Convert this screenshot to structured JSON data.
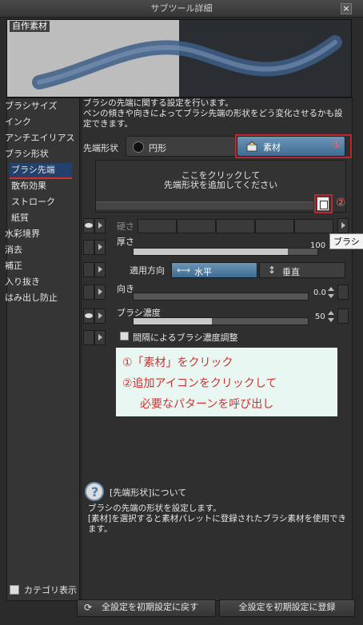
{
  "window": {
    "title": "サブツール詳細",
    "close_icon": "close-icon"
  },
  "preview": {
    "label": "自作素材"
  },
  "sidebar": {
    "items": [
      {
        "label": "ブラシサイズ",
        "sub": false
      },
      {
        "label": "インク",
        "sub": false
      },
      {
        "label": "アンチエイリアス",
        "sub": false
      },
      {
        "label": "ブラシ形状",
        "sub": false
      },
      {
        "label": "ブラシ先端",
        "sub": true,
        "active": true
      },
      {
        "label": "散布効果",
        "sub": true
      },
      {
        "label": "ストローク",
        "sub": true
      },
      {
        "label": "紙質",
        "sub": true
      },
      {
        "label": "水彩境界",
        "sub": false
      },
      {
        "label": "消去",
        "sub": false
      },
      {
        "label": "補正",
        "sub": false
      },
      {
        "label": "入り抜き",
        "sub": false
      },
      {
        "label": "はみ出し防止",
        "sub": false
      }
    ],
    "category_toggle": "カテゴリ表示"
  },
  "main": {
    "description": [
      "ブラシの先端に関する設定を行います。",
      "ペンの傾きや向きによってブラシ先端の形状をどう変化させるかも設",
      "定できます。"
    ],
    "tip_shape_label": "先端形状",
    "circle_label": "円形",
    "material_label": "素材",
    "marker1": "①",
    "marker2": "②",
    "add_area_line1": "ここをクリックして",
    "add_area_line2": "先端形状を追加してください",
    "hardness_label": "硬さ",
    "thickness_label": "厚さ",
    "thickness_value": "100",
    "apply_direction_label": "適用方向",
    "horizontal_label": "水平",
    "vertical_label": "垂直",
    "direction_label": "向き",
    "direction_value": "0.0",
    "density_label": "ブラシ濃度",
    "density_value": "50",
    "interval_density_label": "間隔によるブラシ濃度調整",
    "tooltip": "ブラシ"
  },
  "note": {
    "line1": "①「素材」をクリック",
    "line2": "②追加アイコンをクリックして",
    "line3": "必要なパターンを呼び出し"
  },
  "help": {
    "title": "[先端形状]について",
    "body": [
      "ブラシの先端の形状を設定します。",
      "[素材]を選択すると素材パレットに登録されたブラシ素材を使用でき",
      "ます。"
    ]
  },
  "footer": {
    "reset_label": "全設定を初期設定に戻す",
    "register_label": "全設定を初期設定に登録"
  },
  "colors": {
    "accent": "#3f6c92",
    "annotation_red": "#c0262b",
    "note_bg": "#e9f7f2"
  }
}
